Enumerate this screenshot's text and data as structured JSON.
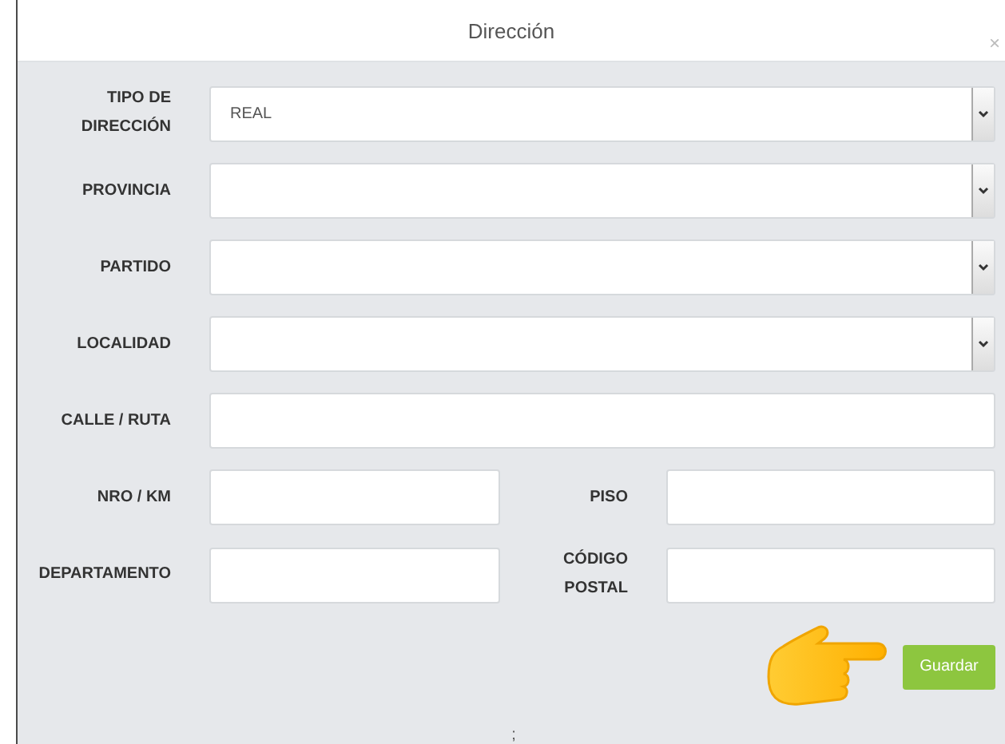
{
  "dialog": {
    "title": "Dirección",
    "close": "×"
  },
  "rows": [
    {
      "fields": [
        {
          "label": "TIPO DE DIRECCIÓN",
          "kind": "select",
          "value": "REAL"
        }
      ]
    },
    {
      "fields": [
        {
          "label": "PROVINCIA",
          "kind": "select"
        }
      ]
    },
    {
      "fields": [
        {
          "label": "PARTIDO",
          "kind": "select"
        }
      ]
    },
    {
      "fields": [
        {
          "label": "LOCALIDAD",
          "kind": "select"
        }
      ]
    },
    {
      "fields": [
        {
          "label": "CALLE / RUTA",
          "kind": "text"
        }
      ]
    },
    {
      "fields": [
        {
          "label": "NRO / KM",
          "kind": "text"
        },
        {
          "label": "PISO",
          "kind": "text"
        }
      ]
    },
    {
      "fields": [
        {
          "label": "DEPARTAMENTO",
          "kind": "text"
        },
        {
          "label": "CÓDIGO POSTAL",
          "kind": "text"
        }
      ]
    }
  ],
  "save_button": "Guardar",
  "footer_text": ";"
}
